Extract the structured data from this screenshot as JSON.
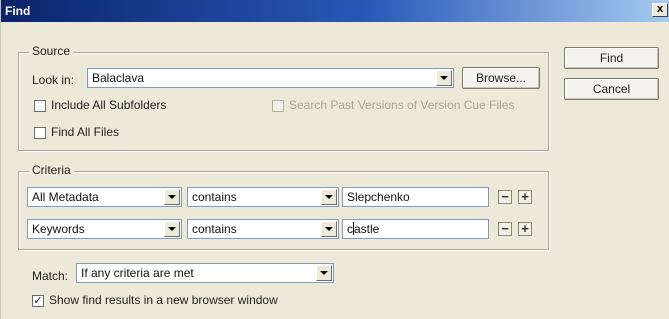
{
  "window": {
    "title": "Find",
    "close_glyph": "x"
  },
  "buttons": {
    "find": "Find",
    "cancel": "Cancel",
    "browse": "Browse..."
  },
  "source": {
    "legend": "Source",
    "look_in_label": "Look in:",
    "look_in_value": "Balaclava",
    "include_subfolders": {
      "label": "Include All Subfolders",
      "checked": false
    },
    "search_past_versions": {
      "label": "Search Past Versions of Version Cue Files",
      "checked": false,
      "enabled": false
    },
    "find_all_files": {
      "label": "Find All Files",
      "checked": false
    }
  },
  "criteria": {
    "legend": "Criteria",
    "rows": [
      {
        "field": "All Metadata",
        "operator": "contains",
        "value": "Slepchenko"
      },
      {
        "field": "Keywords",
        "operator": "contains",
        "value_before_caret": "c",
        "value_after_caret": "astle"
      }
    ],
    "minus_glyph": "−",
    "plus_glyph": "+"
  },
  "match": {
    "label": "Match:",
    "value": "If any criteria are met"
  },
  "show_results": {
    "label": "Show find results in a new browser window",
    "checked": true,
    "check_glyph": "✓"
  }
}
